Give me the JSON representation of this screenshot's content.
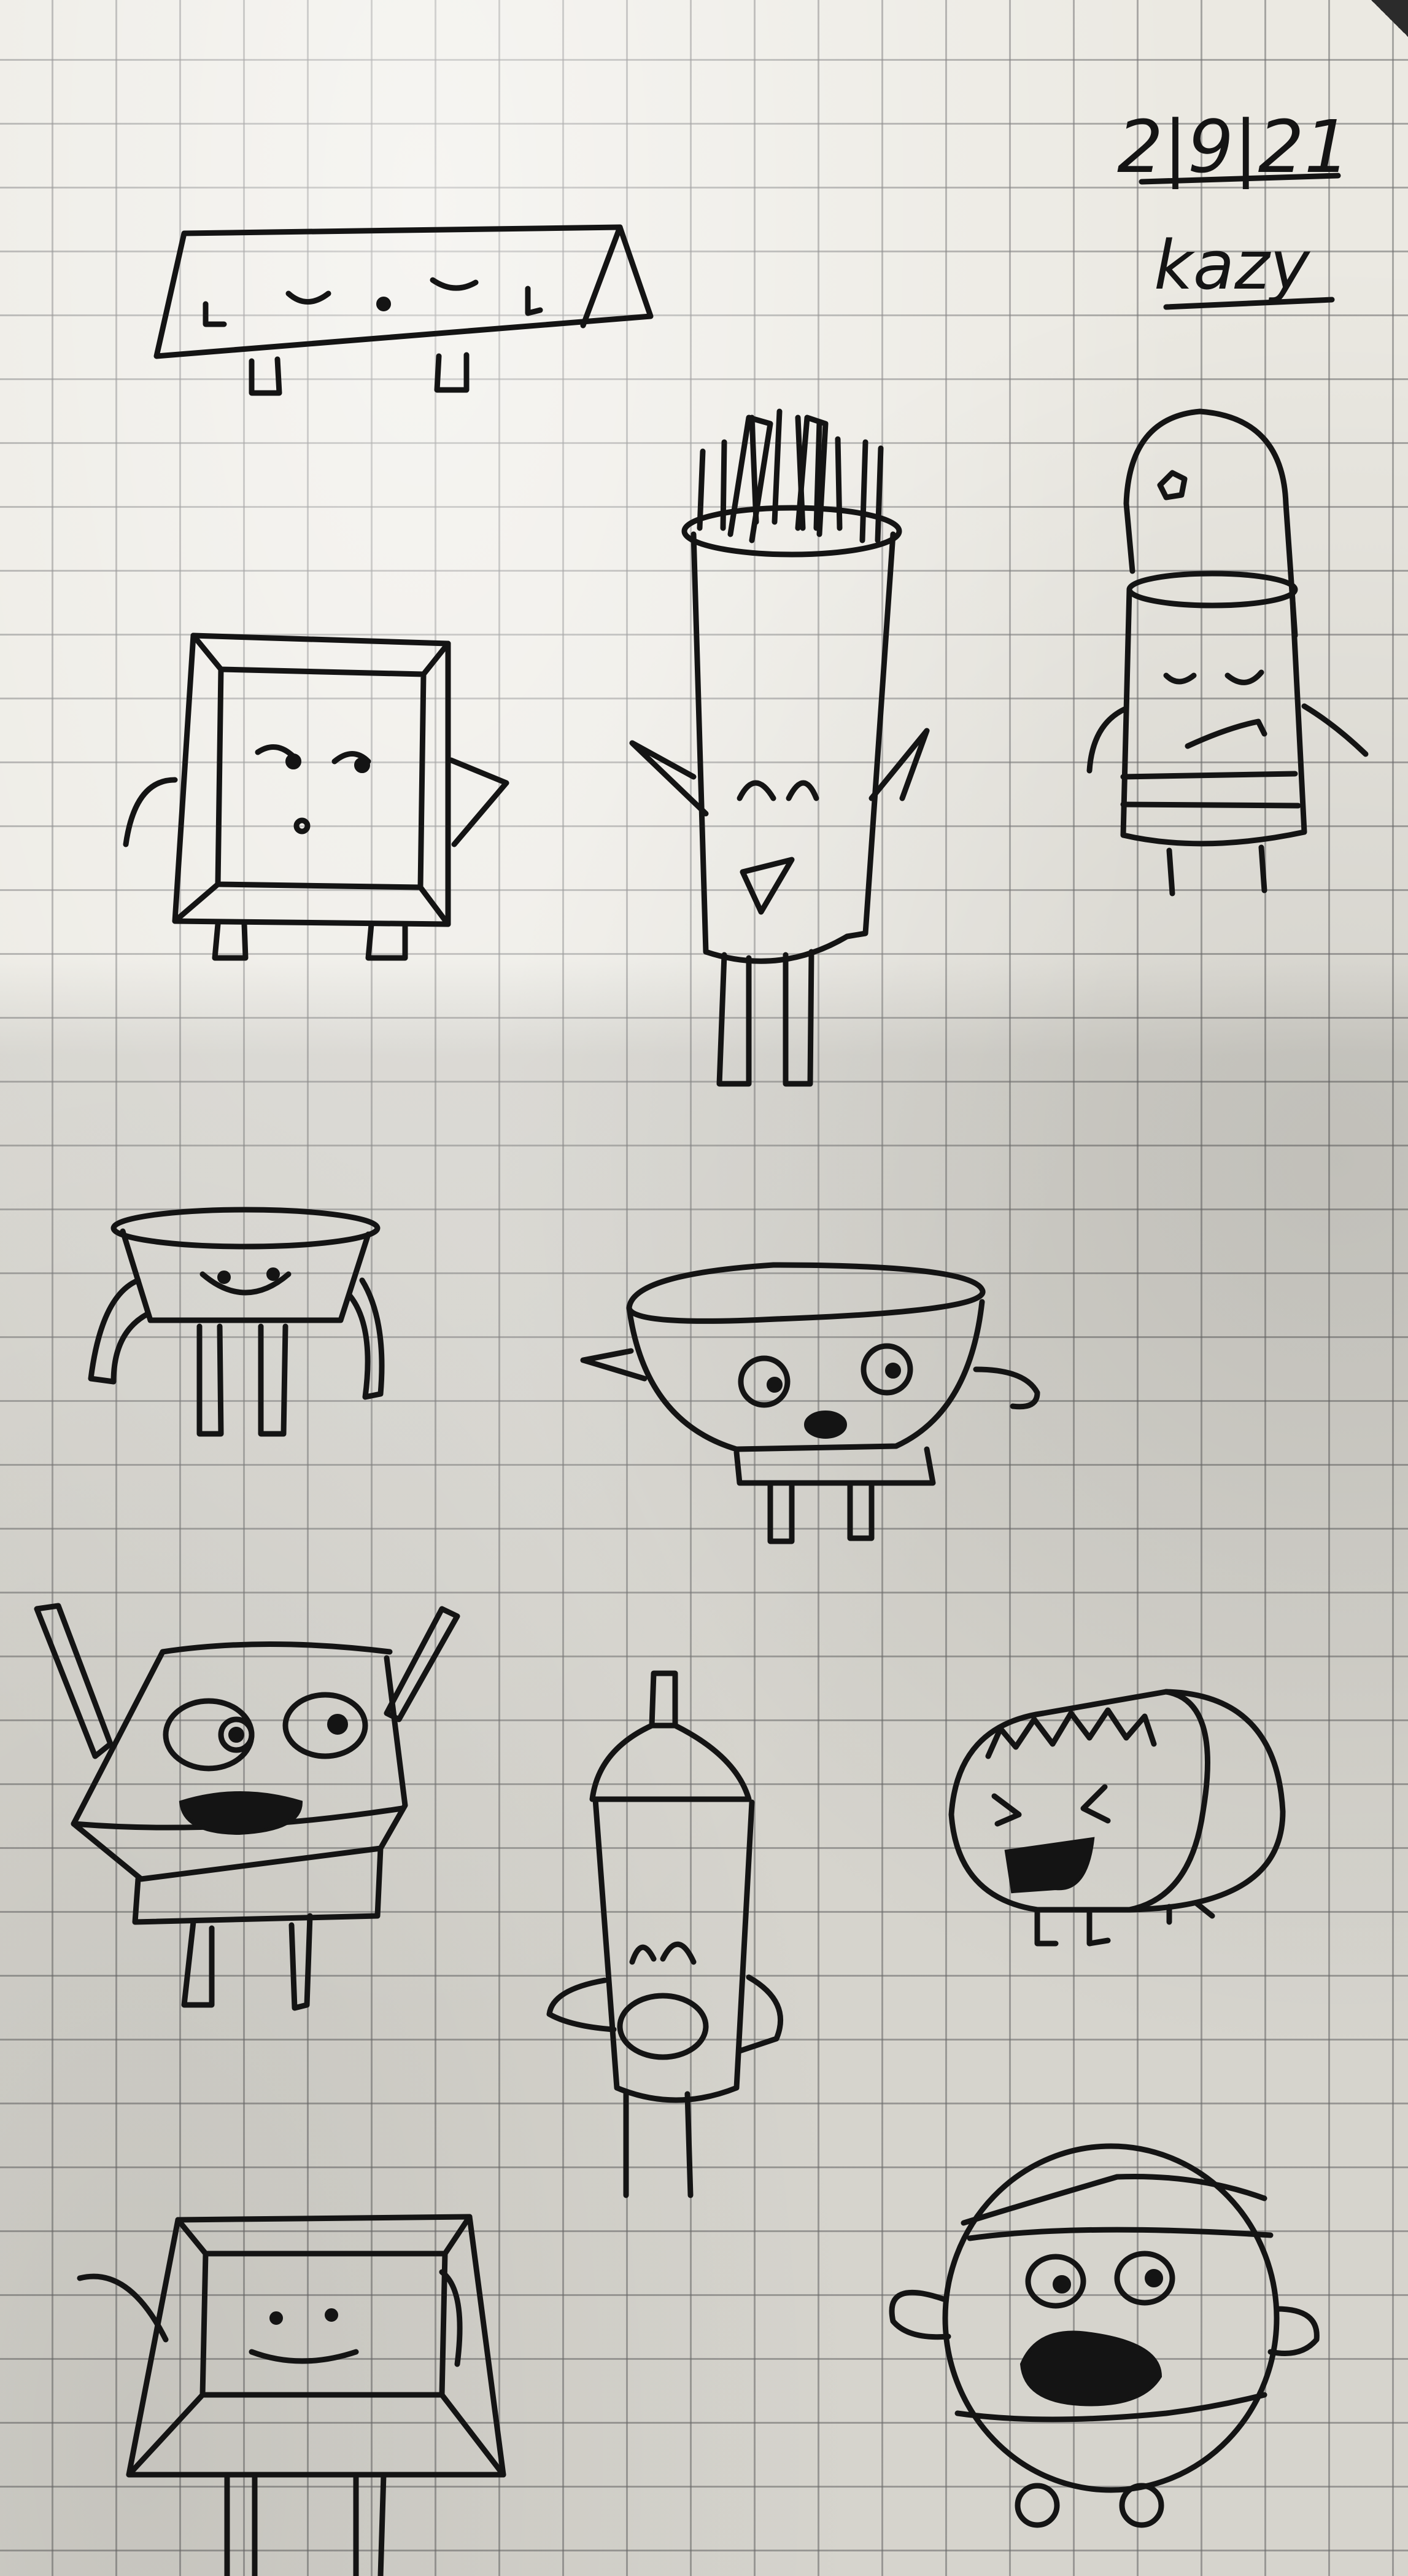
{
  "note": {
    "date": "2|9|21",
    "signature": "kazy"
  },
  "colors": {
    "paper": "#ebe9e2",
    "grid": "#8a8a8a",
    "ink": "#141414"
  }
}
